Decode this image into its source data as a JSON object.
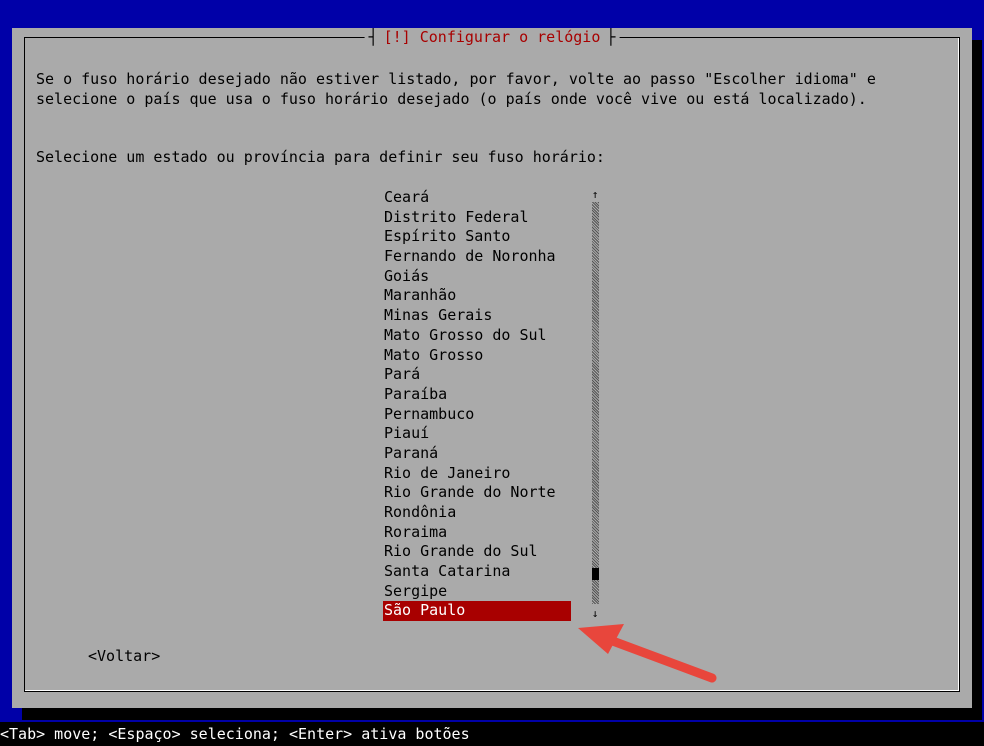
{
  "dialog": {
    "title": "[!] Configurar o relógio",
    "message": "Se o fuso horário desejado não estiver listado, por favor, volte ao passo \"Escolher idioma\" e selecione o país que usa o fuso horário desejado (o país onde você vive ou está localizado).",
    "prompt": "Selecione um estado ou província para definir seu fuso horário:",
    "items": [
      "Ceará",
      "Distrito Federal",
      "Espírito Santo",
      "Fernando de Noronha",
      "Goiás",
      "Maranhão",
      "Minas Gerais",
      "Mato Grosso do Sul",
      "Mato Grosso",
      "Pará",
      "Paraíba",
      "Pernambuco",
      "Piauí",
      "Paraná",
      "Rio de Janeiro",
      "Rio Grande do Norte",
      "Rondônia",
      "Roraima",
      "Rio Grande do Sul",
      "Santa Catarina",
      "Sergipe",
      "São Paulo"
    ],
    "selected_item": "São Paulo",
    "scroll_up": "↑",
    "scroll_down": "↓",
    "back_button": "<Voltar>"
  },
  "status_bar": "<Tab> move; <Espaço> seleciona; <Enter> ativa botões",
  "colors": {
    "background": "#0000a8",
    "dialog": "#aaaaaa",
    "title": "#a80000",
    "selection": "#a80000",
    "annotation_arrow": "#e8463c"
  },
  "icons": {
    "annotation": "red-arrow-icon"
  }
}
